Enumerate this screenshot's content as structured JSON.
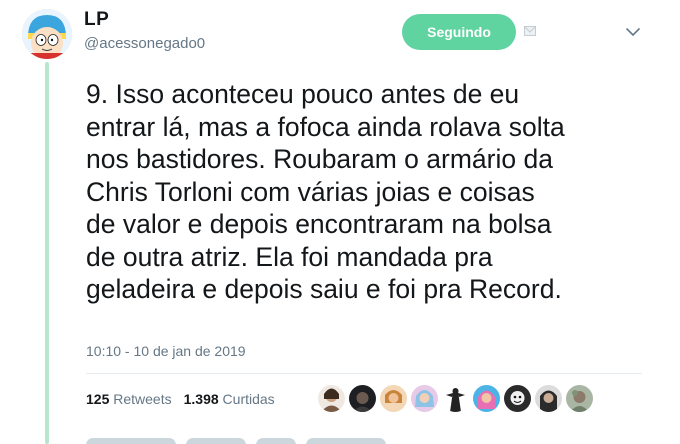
{
  "user": {
    "name": "LP",
    "handle": "@acessonegado0"
  },
  "follow_button": {
    "label": "Seguindo"
  },
  "tweet": {
    "lines": [
      "9. Isso aconteceu pouco antes de eu",
      "entrar lá, mas a fofoca ainda rolava solta",
      "nos bastidores. Roubaram o armário da",
      "Chris Torloni com várias joias e coisas",
      "de valor e depois encontraram na bolsa",
      "de outra atriz. Ela foi mandada pra",
      "geladeira e depois saiu e foi pra Record."
    ],
    "timestamp": "10:10 - 10 de jan de 2019"
  },
  "stats": {
    "retweets_count": "125",
    "retweets_label": "Retweets",
    "likes_count": "1.398",
    "likes_label": "Curtidas"
  },
  "liker_avatars": [
    "avatar-1",
    "avatar-2",
    "avatar-3",
    "avatar-4",
    "avatar-5",
    "avatar-6",
    "avatar-7",
    "avatar-8",
    "avatar-9"
  ],
  "colors": {
    "accent": "#5fd3a0",
    "thread_line": "#b8e6cc",
    "muted_text": "#657786",
    "text": "#14171a"
  }
}
